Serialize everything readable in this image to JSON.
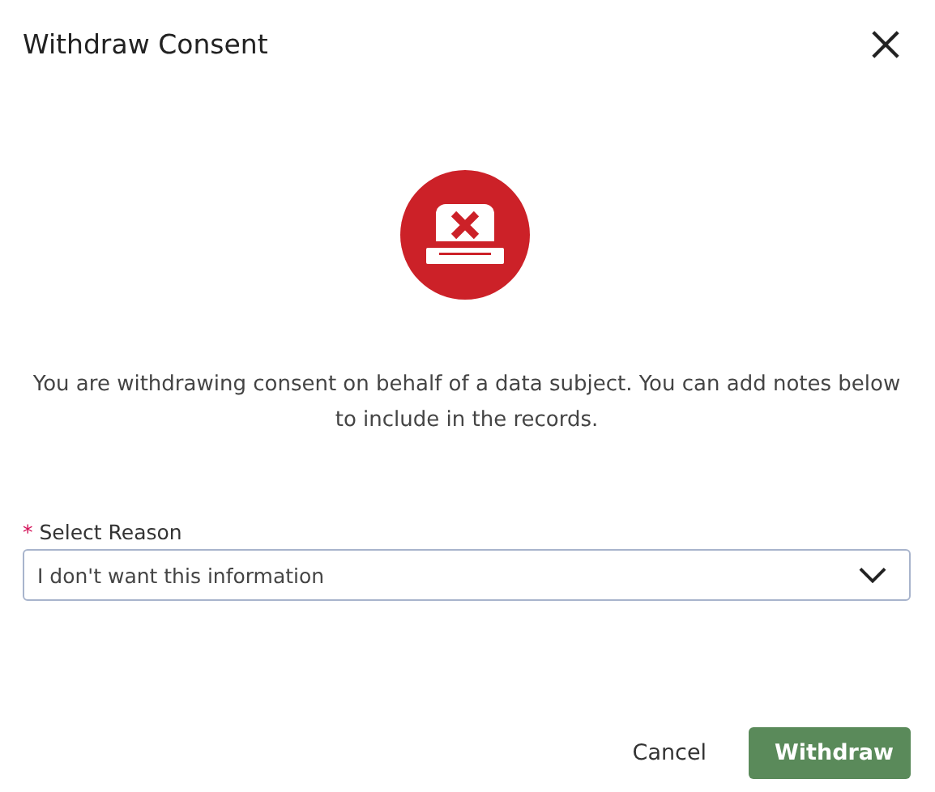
{
  "dialog": {
    "title": "Withdraw Consent"
  },
  "message": "You are withdrawing consent on behalf of a data subject. You can add notes below to include in the records.",
  "reason_field": {
    "required_marker": "*",
    "label": "Select Reason",
    "value": "I don't want this information"
  },
  "buttons": [
    {
      "kind": "secondary",
      "label": "Cancel"
    },
    {
      "kind": "primary",
      "label": "Withdraw"
    }
  ]
}
